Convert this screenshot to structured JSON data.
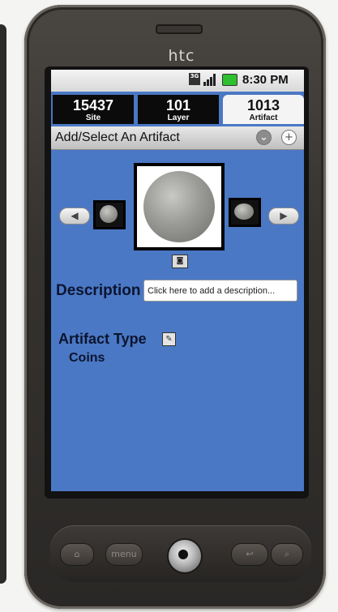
{
  "device": {
    "brand": "htc"
  },
  "status_bar": {
    "network": "3G",
    "time": "8:30 PM",
    "battery_color": "#2ec02e"
  },
  "tabs": [
    {
      "value": "15437",
      "label": "Site",
      "active": false
    },
    {
      "value": "101",
      "label": "Layer",
      "active": false
    },
    {
      "value": "1013",
      "label": "Artifact",
      "active": true
    }
  ],
  "titlebar": {
    "title": "Add/Select An Artifact",
    "dropdown_icon": "chevron-down-icon",
    "add_icon": "plus-icon"
  },
  "gallery": {
    "prev_icon": "arrow-left-icon",
    "next_icon": "arrow-right-icon",
    "camera_icon": "camera-icon"
  },
  "description": {
    "label": "Description",
    "placeholder": "Click here to add a description..."
  },
  "artifact_type": {
    "label": "Artifact Type",
    "value": "Coins",
    "edit_icon": "pencil-icon"
  },
  "hardware_buttons": {
    "home": "home-icon",
    "menu_label": "menu",
    "back": "back-icon",
    "search": "search-icon"
  },
  "colors": {
    "screen_background": "#4a78c4",
    "text_dark": "#0c1430"
  }
}
